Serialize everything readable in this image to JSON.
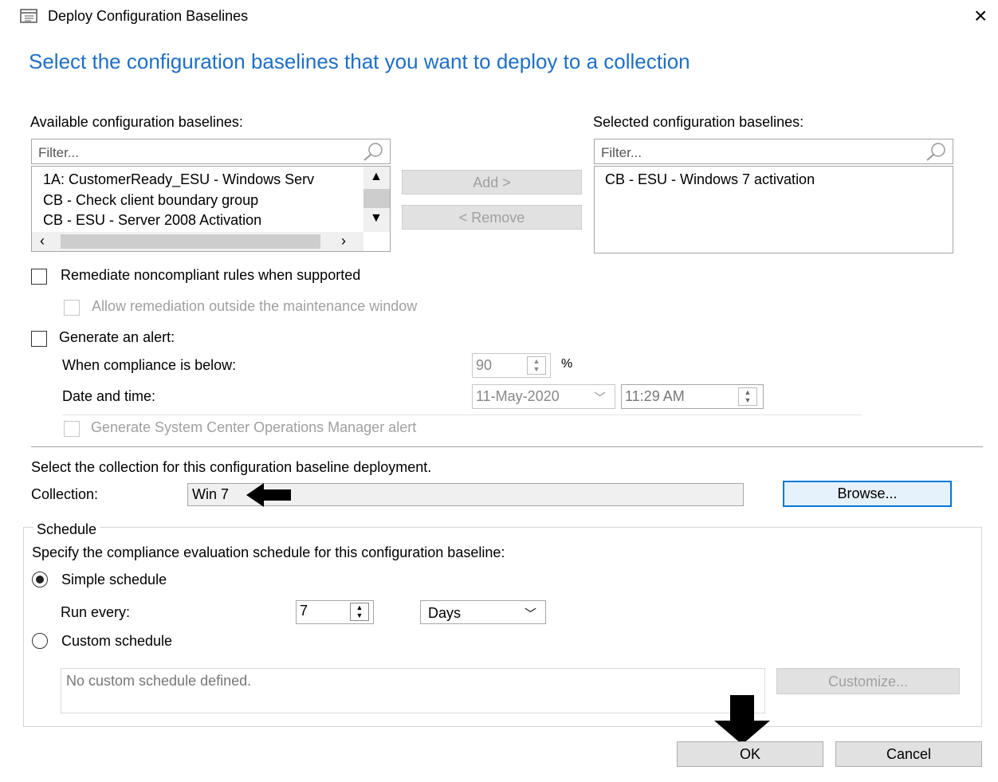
{
  "window": {
    "title": "Deploy Configuration Baselines",
    "close_glyph": "×"
  },
  "heading": "Select the configuration baselines that you want to deploy to a collection",
  "available": {
    "label": "Available configuration baselines:",
    "filter_placeholder": "Filter...",
    "items": [
      "1A:  CustomerReady_ESU - Windows Serv",
      "CB - Check client boundary group",
      "CB - ESU - Server 2008 Activation"
    ]
  },
  "selected": {
    "label": "Selected configuration baselines:",
    "filter_placeholder": "Filter...",
    "items": [
      "CB - ESU - Windows 7 activation"
    ]
  },
  "buttons": {
    "add": "Add >",
    "remove": "< Remove",
    "browse": "Browse...",
    "customize": "Customize...",
    "ok": "OK",
    "cancel": "Cancel"
  },
  "options": {
    "remediate": "Remediate noncompliant rules when supported",
    "allow_remediation": "Allow remediation outside the maintenance window",
    "generate_alert": "Generate an alert:",
    "compliance_below": "When compliance is below:",
    "compliance_value": "90",
    "percent": "%",
    "date_time": "Date and time:",
    "date": "11-May-2020",
    "time": "11:29 AM",
    "scom_alert": "Generate System Center Operations Manager alert"
  },
  "collection": {
    "instruction": "Select the collection for this configuration baseline deployment.",
    "label": "Collection:",
    "value": "Win 7"
  },
  "schedule": {
    "group_label": "Schedule",
    "instruction": "Specify the compliance evaluation schedule for this configuration baseline:",
    "simple": "Simple schedule",
    "run_every": "Run every:",
    "run_value": "7",
    "unit": "Days",
    "custom": "Custom schedule",
    "custom_text": "No custom schedule defined."
  }
}
